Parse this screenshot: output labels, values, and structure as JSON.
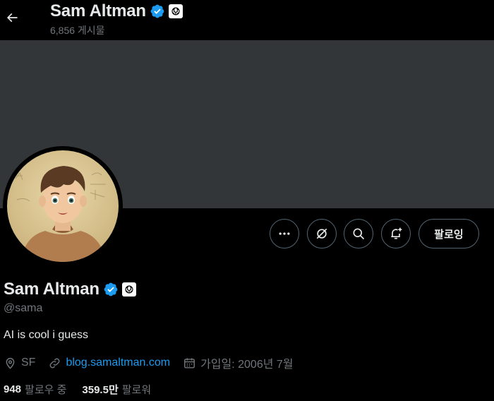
{
  "header": {
    "name": "Sam Altman",
    "post_count": "6,856 게시물"
  },
  "profile": {
    "display_name": "Sam Altman",
    "handle": "@sama",
    "bio": "AI is cool i guess",
    "location": "SF",
    "website": "blog.samaltman.com",
    "joined": "가입일: 2006년 7월"
  },
  "stats": {
    "following_count": "948",
    "following_label": "팔로우 중",
    "followers_count": "359.5만",
    "followers_label": "팔로워"
  },
  "actions": {
    "more": "more-icon",
    "grok": "grok-icon",
    "search": "search-icon",
    "notify": "notification-add-icon",
    "follow_label": "팔로잉"
  },
  "colors": {
    "background": "#000000",
    "banner": "#333639",
    "verified": "#1d9bf0",
    "link": "#1d9bf0",
    "secondary_text": "#71767b"
  }
}
